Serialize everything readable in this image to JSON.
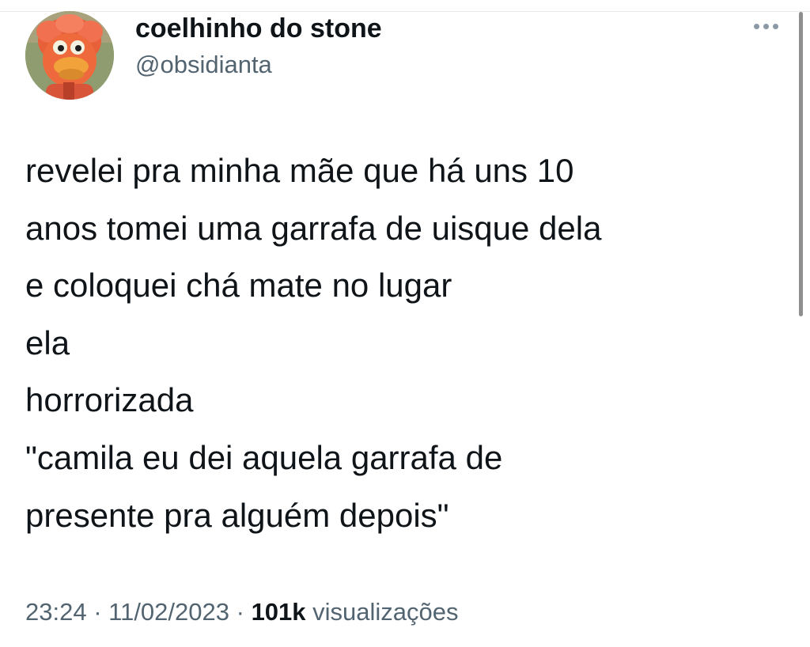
{
  "author": {
    "display_name": "coelhinho do stone",
    "handle": "@obsidianta",
    "avatar_icon": "orange-bird-puppet-avatar"
  },
  "more_icon": "more-horizontal-icon",
  "tweet": {
    "text": "revelei pra minha mãe que há uns 10\nanos tomei uma garrafa de uisque dela\ne coloquei chá mate no lugar\nela\nhorrorizada\n\"camila eu dei aquela garrafa de\npresente pra alguém depois\""
  },
  "meta": {
    "time": "23:24",
    "separator": " · ",
    "date": "11/02/2023",
    "views_count": "101k",
    "views_label": " visualizações"
  },
  "colors": {
    "text": "#0f1419",
    "secondary": "#536471",
    "scrollbar": "#8f8f8f"
  }
}
